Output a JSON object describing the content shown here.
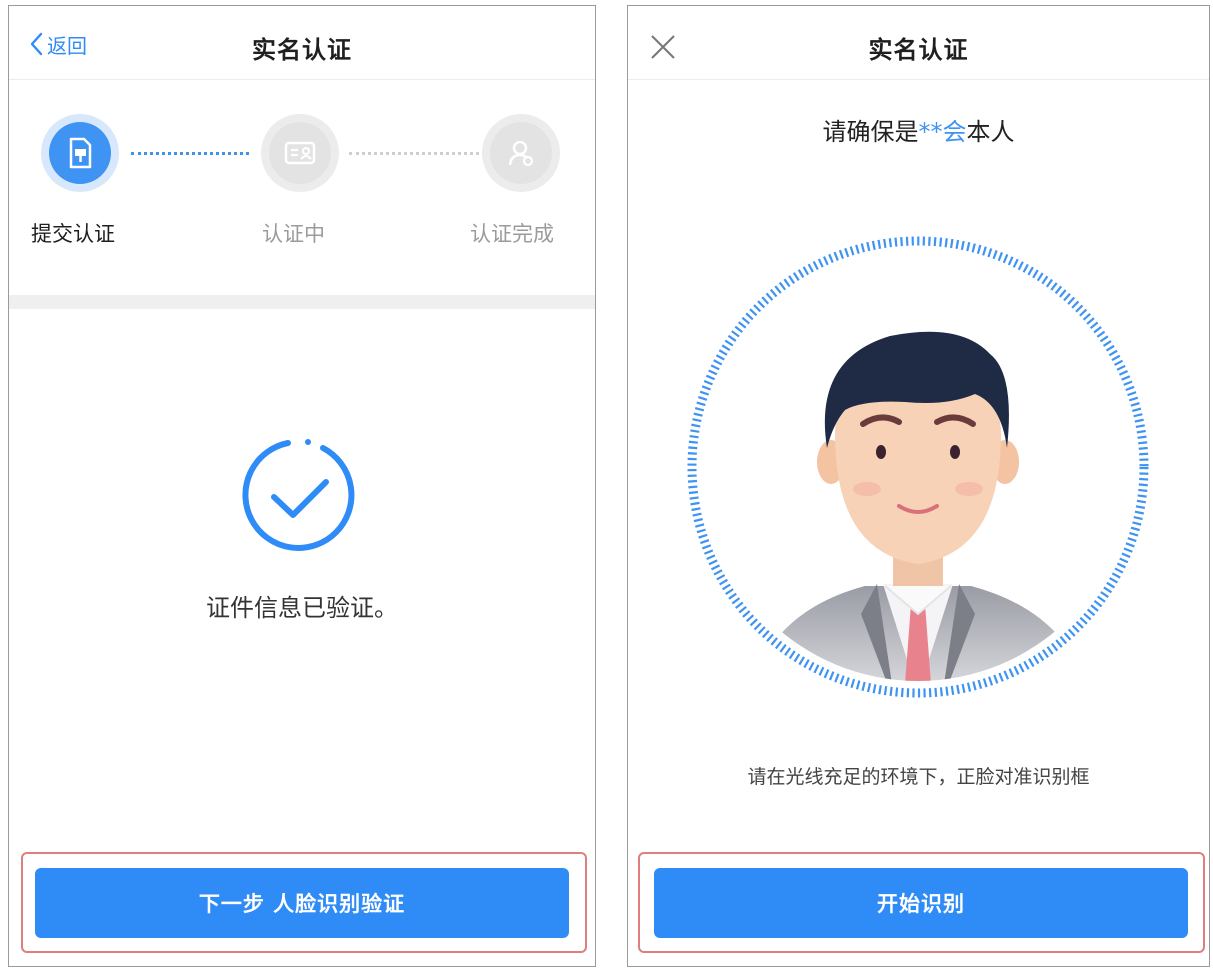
{
  "left_screen": {
    "nav": {
      "back_label": "返回",
      "title": "实名认证"
    },
    "steps": [
      {
        "label": "提交认证",
        "state": "active",
        "icon": "document-icon"
      },
      {
        "label": "认证中",
        "state": "pending",
        "icon": "id-card-icon"
      },
      {
        "label": "认证完成",
        "state": "pending",
        "icon": "user-check-icon"
      }
    ],
    "status_text": "证件信息已验证。",
    "status_icon": "check-circle-icon",
    "primary_button": "下一步 人脸识别验证"
  },
  "right_screen": {
    "nav": {
      "close_icon": "close-icon",
      "title": "实名认证"
    },
    "confirm": {
      "prefix": "请确保是",
      "name": "**会",
      "suffix": "本人"
    },
    "face_illustration": "face-avatar-icon",
    "hint": "请在光线充足的环境下，正脸对准识别框",
    "primary_button": "开始识别"
  },
  "colors": {
    "accent": "#2f8cf6",
    "highlight_frame": "#e07d7d",
    "inactive": "#9b9b9b"
  }
}
